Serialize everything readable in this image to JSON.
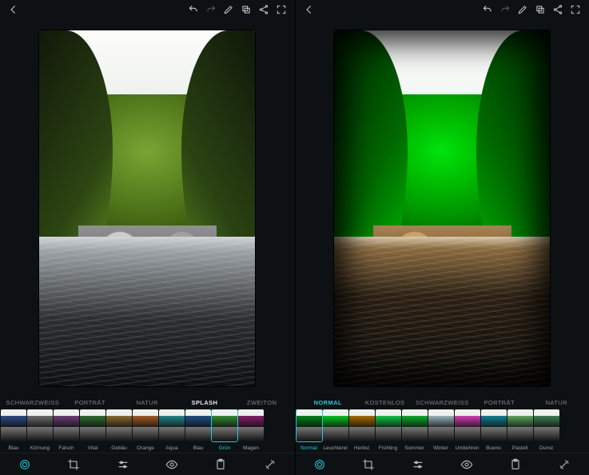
{
  "colors": {
    "accent": "#1fc7d9",
    "bg": "#0d1113",
    "text": "#d9dde0",
    "muted": "#7d848a"
  },
  "left": {
    "categories": [
      {
        "label": "SCHWARZWEISS",
        "selected": false
      },
      {
        "label": "PORTRÄT",
        "selected": false
      },
      {
        "label": "NATUR",
        "selected": false
      },
      {
        "label": "SPLASH",
        "selected": true
      },
      {
        "label": "ZWEITON",
        "selected": false
      }
    ],
    "filters": [
      {
        "label": "Blau",
        "selected": false
      },
      {
        "label": "Körnung",
        "selected": false
      },
      {
        "label": "Falsch",
        "selected": false
      },
      {
        "label": "Vital",
        "selected": false
      },
      {
        "label": "Gebäu",
        "selected": false
      },
      {
        "label": "Orange",
        "selected": false
      },
      {
        "label": "Aqua",
        "selected": false
      },
      {
        "label": "Blau",
        "selected": false
      },
      {
        "label": "Grün",
        "selected": true
      },
      {
        "label": "Magen",
        "selected": false
      }
    ],
    "filter_tints": [
      "#2b4b8a",
      "#6b6b6b",
      "#6e3e7a",
      "#2e6e2e",
      "#8a6b2b",
      "#a85a1e",
      "#1e8a8a",
      "#1e4f8a",
      "#2e8a2e",
      "#8a1e6e"
    ]
  },
  "right": {
    "categories": [
      {
        "label": "NORMAL",
        "selected": true
      },
      {
        "label": "KOSTENLOS",
        "selected": false
      },
      {
        "label": "SCHWARZWEISS",
        "selected": false
      },
      {
        "label": "PORTRÄT",
        "selected": false
      },
      {
        "label": "NATUR",
        "selected": false
      }
    ],
    "filters": [
      {
        "label": "Normal",
        "selected": true
      },
      {
        "label": "Leuchtend",
        "selected": false
      },
      {
        "label": "Herbst",
        "selected": false
      },
      {
        "label": "Frühling",
        "selected": false
      },
      {
        "label": "Sommer",
        "selected": false
      },
      {
        "label": "Winter",
        "selected": false
      },
      {
        "label": "Umkehren",
        "selected": false
      },
      {
        "label": "Bueno",
        "selected": false
      },
      {
        "label": "Pastell",
        "selected": false
      },
      {
        "label": "Dunst",
        "selected": false
      }
    ],
    "filter_tints": [
      "#177a2a",
      "#29b53d",
      "#9a6b1e",
      "#33b85a",
      "#2aa040",
      "#9fb1b8",
      "#b84aa0",
      "#2a7a8a",
      "#6aa06a",
      "#4a7a5a"
    ]
  },
  "toolbar_icons": [
    "looks-icon",
    "crop-icon",
    "sliders-icon",
    "eye-icon",
    "clipboard-icon",
    "magic-icon"
  ]
}
